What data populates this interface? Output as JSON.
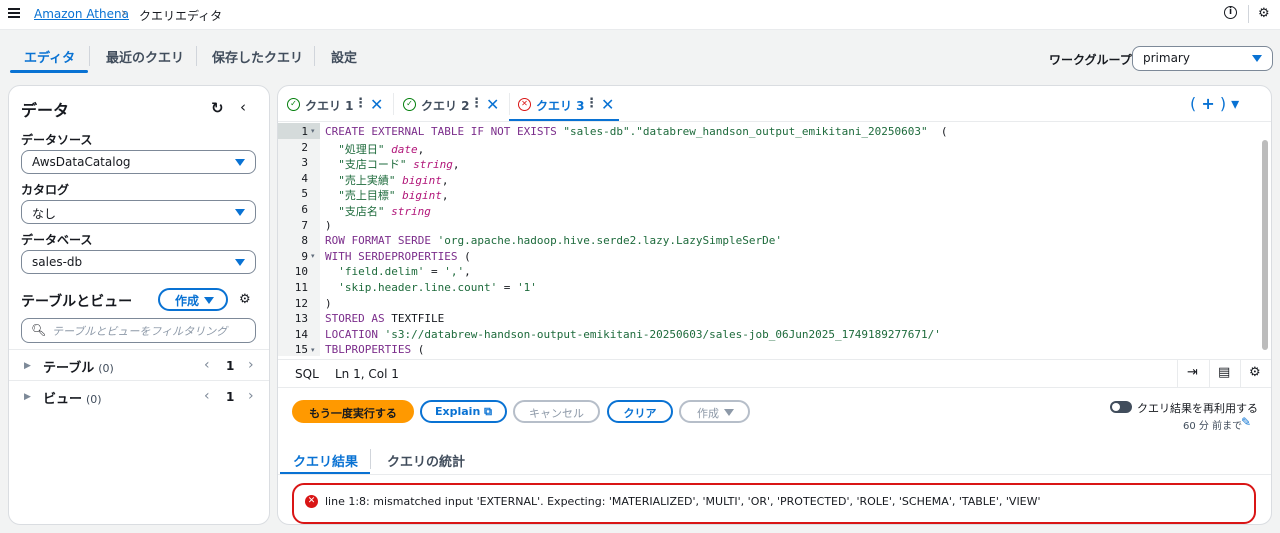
{
  "breadcrumb": {
    "link": "Amazon Athena",
    "current": "クエリエディタ"
  },
  "top_tabs": [
    "エディタ",
    "最近のクエリ",
    "保存したクエリ",
    "設定"
  ],
  "workgroup": {
    "label": "ワークグループ",
    "value": "primary"
  },
  "data_panel": {
    "title": "データ",
    "data_source_label": "データソース",
    "data_source_value": "AwsDataCatalog",
    "catalog_label": "カタログ",
    "catalog_value": "なし",
    "database_label": "データベース",
    "database_value": "sales-db",
    "tables_views_title": "テーブルとビュー",
    "create_label": "作成",
    "filter_placeholder": "テーブルとビューをフィルタリング",
    "tables": {
      "label": "テーブル",
      "count": "(0)",
      "page": "1"
    },
    "views": {
      "label": "ビュー",
      "count": "(0)",
      "page": "1"
    }
  },
  "query_tabs": [
    {
      "label": "クエリ 1",
      "status": "success"
    },
    {
      "label": "クエリ 2",
      "status": "success"
    },
    {
      "label": "クエリ 3",
      "status": "error"
    }
  ],
  "code_lines": [
    {
      "n": "1",
      "parts": [
        [
          "kw",
          "CREATE EXTERNAL TABLE IF NOT EXISTS "
        ],
        [
          "str",
          "\"sales-db\".\"databrew_handson_output_emikitani_20250603\""
        ],
        [
          "",
          "  ("
        ]
      ]
    },
    {
      "n": "2",
      "parts": [
        [
          "str",
          "  \"処理日\""
        ],
        [
          "ty",
          " date"
        ],
        [
          "",
          ","
        ]
      ]
    },
    {
      "n": "3",
      "parts": [
        [
          "str",
          "  \"支店コード\""
        ],
        [
          "ty",
          " string"
        ],
        [
          "",
          ","
        ]
      ]
    },
    {
      "n": "4",
      "parts": [
        [
          "str",
          "  \"売上実績\""
        ],
        [
          "ty",
          " bigint"
        ],
        [
          "",
          ","
        ]
      ]
    },
    {
      "n": "5",
      "parts": [
        [
          "str",
          "  \"売上目標\""
        ],
        [
          "ty",
          " bigint"
        ],
        [
          "",
          ","
        ]
      ]
    },
    {
      "n": "6",
      "parts": [
        [
          "str",
          "  \"支店名\""
        ],
        [
          "ty",
          " string"
        ]
      ]
    },
    {
      "n": "7",
      "parts": [
        [
          "",
          ")"
        ]
      ]
    },
    {
      "n": "8",
      "parts": [
        [
          "kw",
          "ROW FORMAT SERDE "
        ],
        [
          "str",
          "'org.apache.hadoop.hive.serde2.lazy.LazySimpleSerDe'"
        ]
      ]
    },
    {
      "n": "9",
      "parts": [
        [
          "kw",
          "WITH SERDEPROPERTIES "
        ],
        [
          "",
          "("
        ]
      ]
    },
    {
      "n": "10",
      "parts": [
        [
          "str",
          "  'field.delim'"
        ],
        [
          "",
          " = "
        ],
        [
          "str",
          "','"
        ],
        [
          "",
          ","
        ]
      ]
    },
    {
      "n": "11",
      "parts": [
        [
          "str",
          "  'skip.header.line.count'"
        ],
        [
          "",
          " = "
        ],
        [
          "str",
          "'1'"
        ]
      ]
    },
    {
      "n": "12",
      "parts": [
        [
          "",
          ")"
        ]
      ]
    },
    {
      "n": "13",
      "parts": [
        [
          "kw",
          "STORED AS "
        ],
        [
          "",
          "TEXTFILE"
        ]
      ]
    },
    {
      "n": "14",
      "parts": [
        [
          "kw",
          "LOCATION "
        ],
        [
          "str",
          "'s3://databrew-handson-output-emikitani-20250603/sales-job_06Jun2025_1749189277671/'"
        ]
      ]
    },
    {
      "n": "15",
      "parts": [
        [
          "kw",
          "TBLPROPERTIES "
        ],
        [
          "",
          "("
        ]
      ]
    }
  ],
  "status_bar": {
    "language": "SQL",
    "cursor": "Ln 1, Col 1"
  },
  "actions": {
    "run": "もう一度実行する",
    "explain": "Explain",
    "cancel": "キャンセル",
    "clear": "クリア",
    "create": "作成",
    "reuse_label": "クエリ結果を再利用する",
    "reuse_time": "60 分 前まで"
  },
  "result_tabs": [
    "クエリ結果",
    "クエリの統計"
  ],
  "error_message": "line 1:8: mismatched input 'EXTERNAL'. Expecting: 'MATERIALIZED', 'MULTI', 'OR', 'PROTECTED', 'ROLE', 'SCHEMA', 'TABLE', 'VIEW'",
  "colors": {
    "accent": "#0972d3",
    "run_button": "#ff9900",
    "error": "#d91515",
    "success": "#037f0c"
  }
}
